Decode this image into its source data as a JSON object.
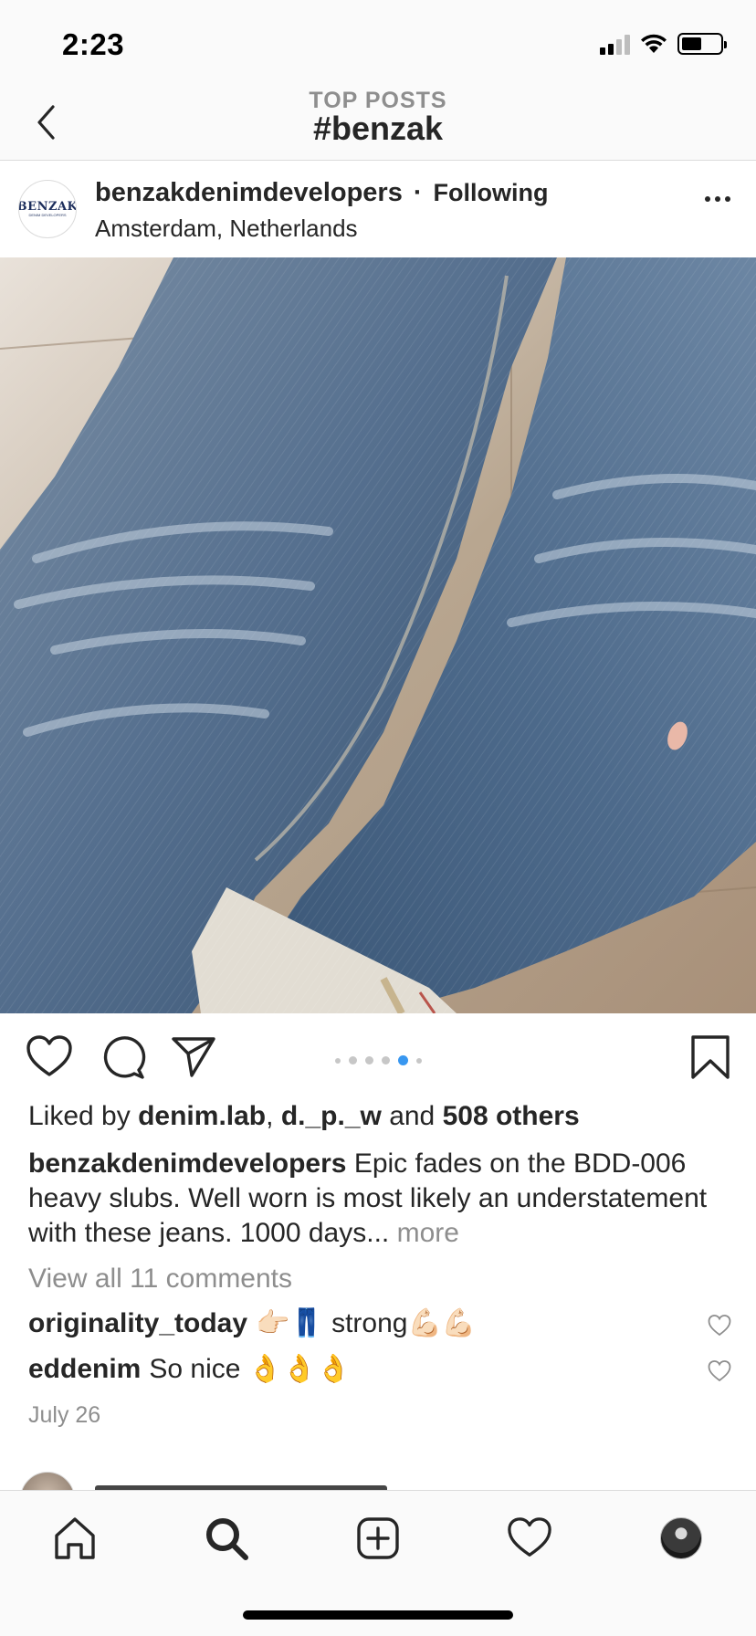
{
  "status_bar": {
    "time": "2:23"
  },
  "header": {
    "subtitle": "TOP POSTS",
    "title": "#benzak"
  },
  "post": {
    "avatar_logo": "BENZAK",
    "avatar_logo_sub": "DENIM DEVELOPERS",
    "username": "benzakdenimdevelopers",
    "separator": "·",
    "follow_status": "Following",
    "location": "Amsterdam, Netherlands",
    "carousel": {
      "count": 6,
      "active_index": 4
    },
    "likes": {
      "prefix": "Liked by",
      "user1": "denim.lab",
      "comma": ",",
      "user2": "d._p._w",
      "and": "and",
      "others": "508 others"
    },
    "caption": {
      "username": "benzakdenimdevelopers",
      "text": "Epic fades on the BDD-006 heavy slubs. Well worn is most likely an understatement with these jeans. 1000 days...",
      "more": "more"
    },
    "view_comments": "View all 11 comments",
    "comments": [
      {
        "username": "originality_today",
        "text": "👉🏻👖 strong💪🏻💪🏻"
      },
      {
        "username": "eddenim",
        "text": "So nice 👌👌👌"
      }
    ],
    "date": "July 26"
  }
}
